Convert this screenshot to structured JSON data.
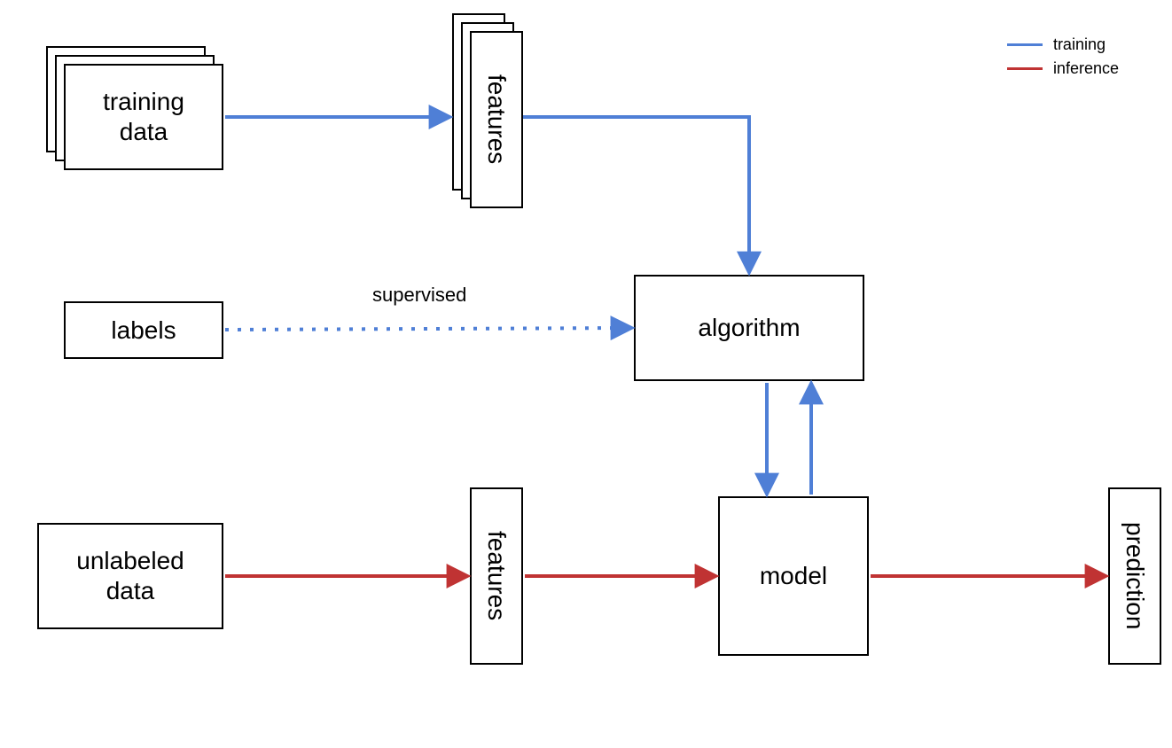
{
  "nodes": {
    "training_data": "training\ndata",
    "features_top": "features",
    "labels": "labels",
    "algorithm": "algorithm",
    "unlabeled_data": "unlabeled\ndata",
    "features_bottom": "features",
    "model": "model",
    "prediction": "prediction"
  },
  "edge_labels": {
    "supervised": "supervised"
  },
  "legend": {
    "training": "training",
    "inference": "inference"
  },
  "colors": {
    "training": "#4f7fd6",
    "inference": "#c03333"
  }
}
